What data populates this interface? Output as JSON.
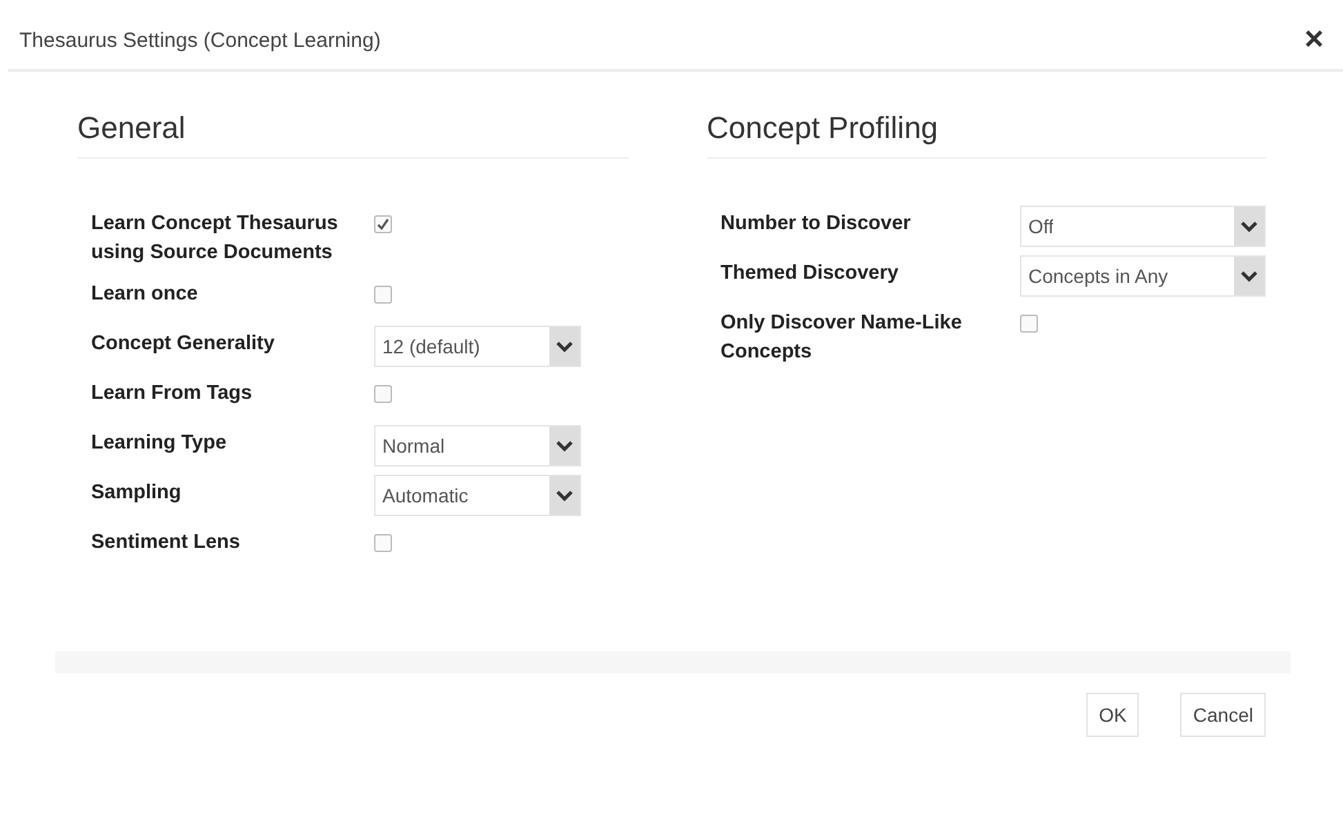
{
  "window": {
    "title": "Thesaurus Settings (Concept Learning)",
    "close": "×"
  },
  "sections": [
    {
      "title": "General",
      "rows": [
        {
          "kind": "checkbox",
          "label": "Learn Concept Thesaurus using Source Documents",
          "checked": true
        },
        {
          "kind": "checkbox",
          "label": "Learn once",
          "checked": false
        },
        {
          "kind": "select",
          "label": "Concept Generality",
          "value": "12 (default)"
        },
        {
          "kind": "checkbox",
          "label": "Learn From Tags",
          "checked": false
        },
        {
          "kind": "select",
          "label": "Learning Type",
          "value": "Normal"
        },
        {
          "kind": "select",
          "label": "Sampling",
          "value": "Automatic"
        },
        {
          "kind": "checkbox",
          "label": "Sentiment Lens",
          "checked": false
        }
      ]
    },
    {
      "title": "Concept Profiling",
      "rows": [
        {
          "kind": "select",
          "label": "Number to Discover",
          "value": "Off"
        },
        {
          "kind": "select",
          "label": "Themed Discovery",
          "value": "Concepts in Any"
        },
        {
          "kind": "checkbox",
          "label": "Only Discover Name-Like Concepts",
          "checked": false
        }
      ]
    }
  ],
  "buttons": [
    "OK",
    "Cancel"
  ]
}
